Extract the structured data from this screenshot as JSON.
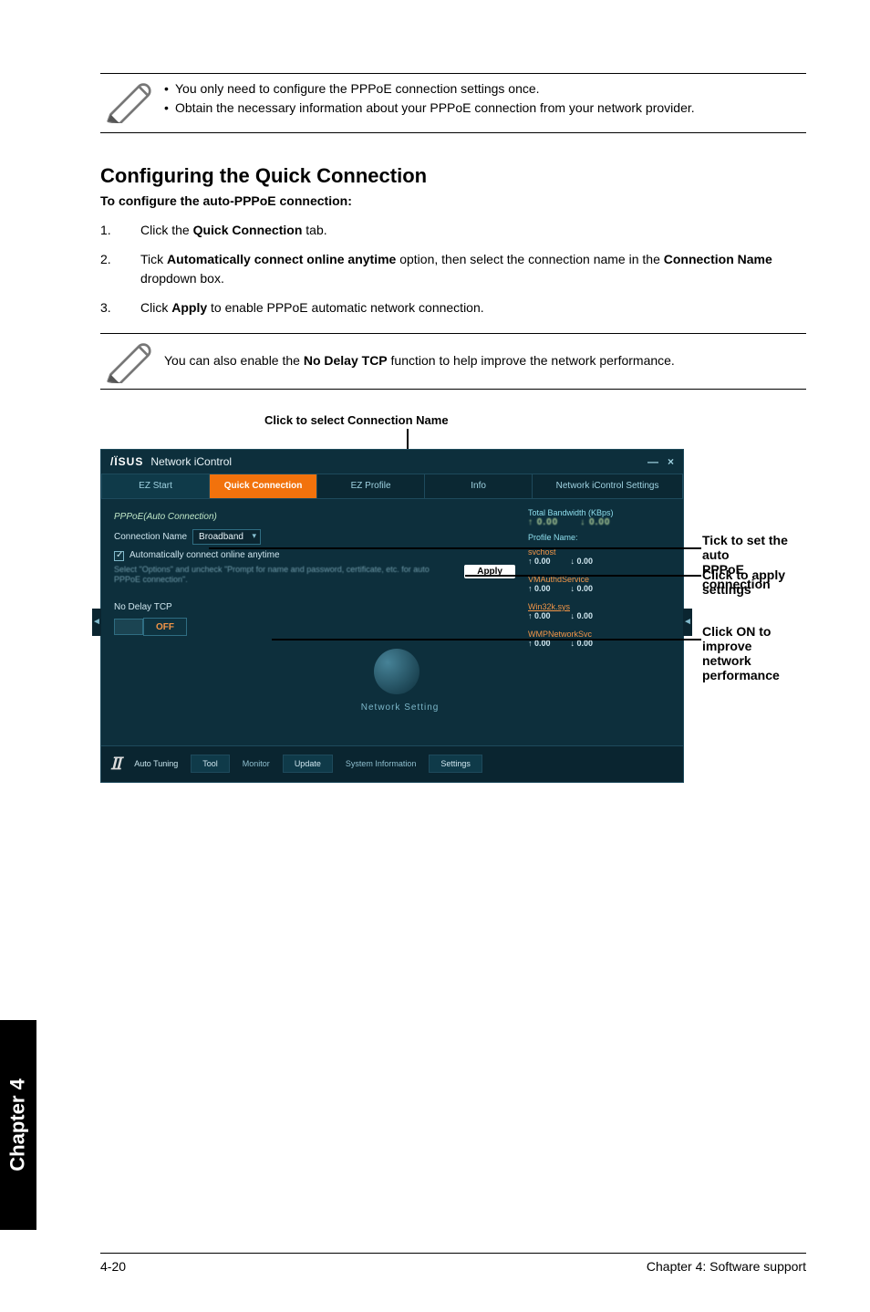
{
  "notes": {
    "first": {
      "b1": "You only need to configure the PPPoE connection settings once.",
      "b2": "Obtain the necessary information about your PPPoE connection from your network provider."
    },
    "second": "You can also enable the No Delay TCP function to help improve the network performance.",
    "second_prefix": "You can also enable the ",
    "second_bold": "No Delay TCP",
    "second_suffix": " function to help improve the network performance."
  },
  "section": {
    "heading": "Configuring the Quick Connection",
    "sub": "To configure the auto-PPPoE connection:"
  },
  "steps": {
    "s1_num": "1.",
    "s1_a": "Click the ",
    "s1_b": "Quick Connection",
    "s1_c": " tab.",
    "s2_num": "2.",
    "s2_a": "Tick ",
    "s2_b": "Automatically connect online anytime",
    "s2_c": " option, then select the connection name in the ",
    "s2_d": "Connection Name",
    "s2_e": " dropdown box.",
    "s3_num": "3.",
    "s3_a": "Click ",
    "s3_b": "Apply",
    "s3_c": " to enable PPPoE automatic network connection."
  },
  "figure": {
    "caption_top": "Click to select Connection Name",
    "window_title": "Network iControl",
    "close": "×",
    "tabs": {
      "t1": "EZ Start",
      "t2": "Quick Connection",
      "t3": "EZ Profile",
      "t4": "Info",
      "t5": "Network iControl Settings"
    },
    "left_panel": {
      "pppoe_title": "PPPoE(Auto Connection)",
      "conn_label": "Connection Name",
      "conn_value": "Broadband",
      "auto_label": "Automatically connect online anytime",
      "hint": "Select \"Options\" and uncheck \"Prompt for name and password, certificate, etc. for auto PPPoE connection\".",
      "apply": "Apply",
      "nodelay_title": "No Delay TCP",
      "off": "OFF",
      "network_setting": "Network Setting"
    },
    "right_panel": {
      "tb_label": "Total Bandwidth (KBps)",
      "up": "↑ 0.00",
      "down": "↓ 0.00",
      "profile_name": "Profile Name:",
      "items": [
        {
          "name": "svchost",
          "u": "↑ 0.00",
          "d": "↓ 0.00"
        },
        {
          "name": "VMAuthdService",
          "u": "↑ 0.00",
          "d": "↓ 0.00"
        },
        {
          "name": "Win32k.sys",
          "u": "↑ 0.00",
          "d": "↓ 0.00",
          "hl": true
        },
        {
          "name": "WMPNetworkSvc",
          "u": "↑ 0.00",
          "d": "↓ 0.00"
        }
      ]
    },
    "bottombar": {
      "brand": "AI",
      "auto": "Auto Tuning",
      "b1": "Tool",
      "b2": "Monitor",
      "b3": "Update",
      "b4": "System Information",
      "b5": "Settings"
    }
  },
  "annotations": {
    "a1": "Tick to set the auto PPPoE connection",
    "a1_l1": "Tick to set the auto",
    "a1_l2": "PPPoE connection",
    "a2": "Click to apply settings",
    "a3": "Click ON to improve network performance",
    "a3_l1": "Click ON to improve",
    "a3_l2": "network performance"
  },
  "chapter_tab": "Chapter 4",
  "footer": {
    "left": "4-20",
    "right": "Chapter 4: Software support"
  }
}
